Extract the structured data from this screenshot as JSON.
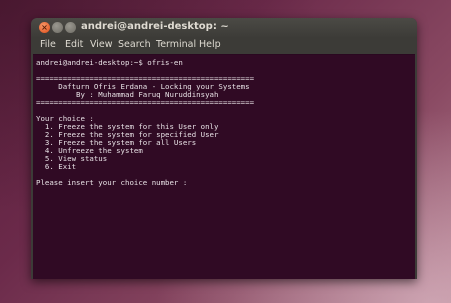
{
  "window": {
    "title": "andrei@andrei-desktop: ~",
    "close_glyph": "×"
  },
  "menubar": {
    "items": [
      "File",
      "Edit",
      "View",
      "Search",
      "Terminal",
      "Help"
    ]
  },
  "terminal": {
    "background": "#300a24",
    "text_color": "#e8e2e6",
    "lines": [
      "andrei@andrei-desktop:~$ ofris-en",
      "",
      "=================================================",
      "     Dafturn Ofris Erdana - Locking your Systems",
      "         By : Muhammad Faruq Nuruddinsyah",
      "=================================================",
      "",
      "Your choice :",
      "  1. Freeze the system for this User only",
      "  2. Freeze the system for specified User",
      "  3. Freeze the system for all Users",
      "  4. Unfreeze the system",
      "  5. View status",
      "  6. Exit",
      "",
      "Please insert your choice number :"
    ]
  }
}
